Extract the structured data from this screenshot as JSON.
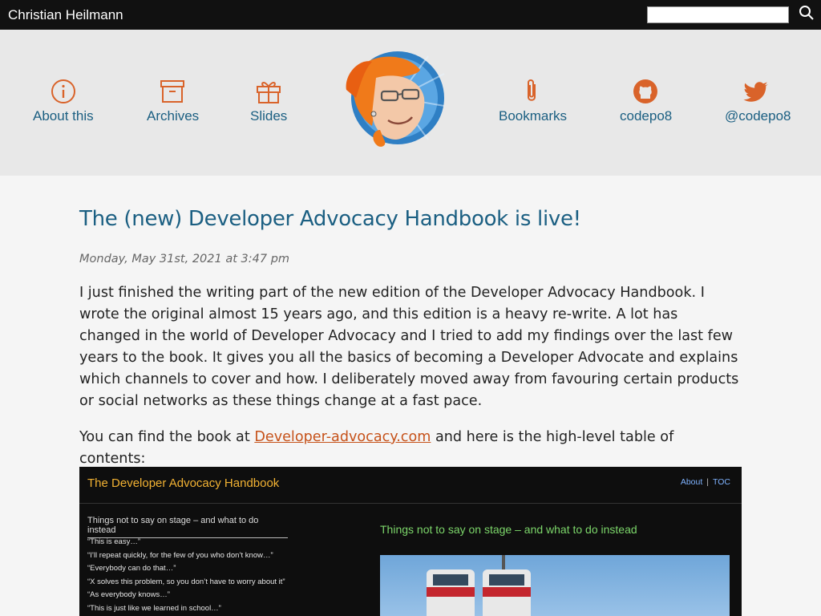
{
  "topbar": {
    "site_name": "Christian Heilmann",
    "search_placeholder": "",
    "search_value": ""
  },
  "nav": {
    "left": [
      {
        "label": "About this",
        "icon": "info-circle-icon"
      },
      {
        "label": "Archives",
        "icon": "archive-box-icon"
      },
      {
        "label": "Slides",
        "icon": "gift-icon"
      }
    ],
    "right": [
      {
        "label": "Bookmarks",
        "icon": "paperclip-icon"
      },
      {
        "label": "codepo8",
        "icon": "github-icon"
      },
      {
        "label": "@codepo8",
        "icon": "twitter-icon"
      }
    ],
    "color": "#1b5f82",
    "icon_color": "#d9632a"
  },
  "post": {
    "title": "The (new) Developer Advocacy Handbook is live!",
    "date": "Monday, May 31st, 2021 at 3:47 pm",
    "paragraph1": "I just finished the writing part of the new edition of the Developer Advocacy Handbook. I wrote the original almost 15 years ago, and this edition is a heavy re-write. A lot has changed in the world of Developer Advocacy and I tried to add my findings over the last few years to the book. It gives you all the basics of becoming a Developer Advocate and explains which channels to cover and how. I deliberately moved away from favouring certain products or social networks as these things change at a fast pace.",
    "paragraph2_before": "You can find the book at ",
    "paragraph2_link": "Developer-advocacy.com",
    "paragraph2_after": " and here is the high-level table of contents:"
  },
  "book_screenshot": {
    "title": "The Developer Advocacy Handbook",
    "nav_about": "About",
    "nav_sep": "|",
    "nav_toc": "TOC",
    "side_title": "Things not to say on stage – and what to do instead",
    "list": [
      "“This is easy…”",
      "“I’ll repeat quickly, for the few of you who don’t know…”",
      "“Everybody can do that…”",
      "“X solves this problem, so you don’t have to worry about it”",
      "“As everybody knows…”",
      "“This is just like we learned in school…”"
    ],
    "main_title": "Things not to say on stage – and what to do instead"
  }
}
